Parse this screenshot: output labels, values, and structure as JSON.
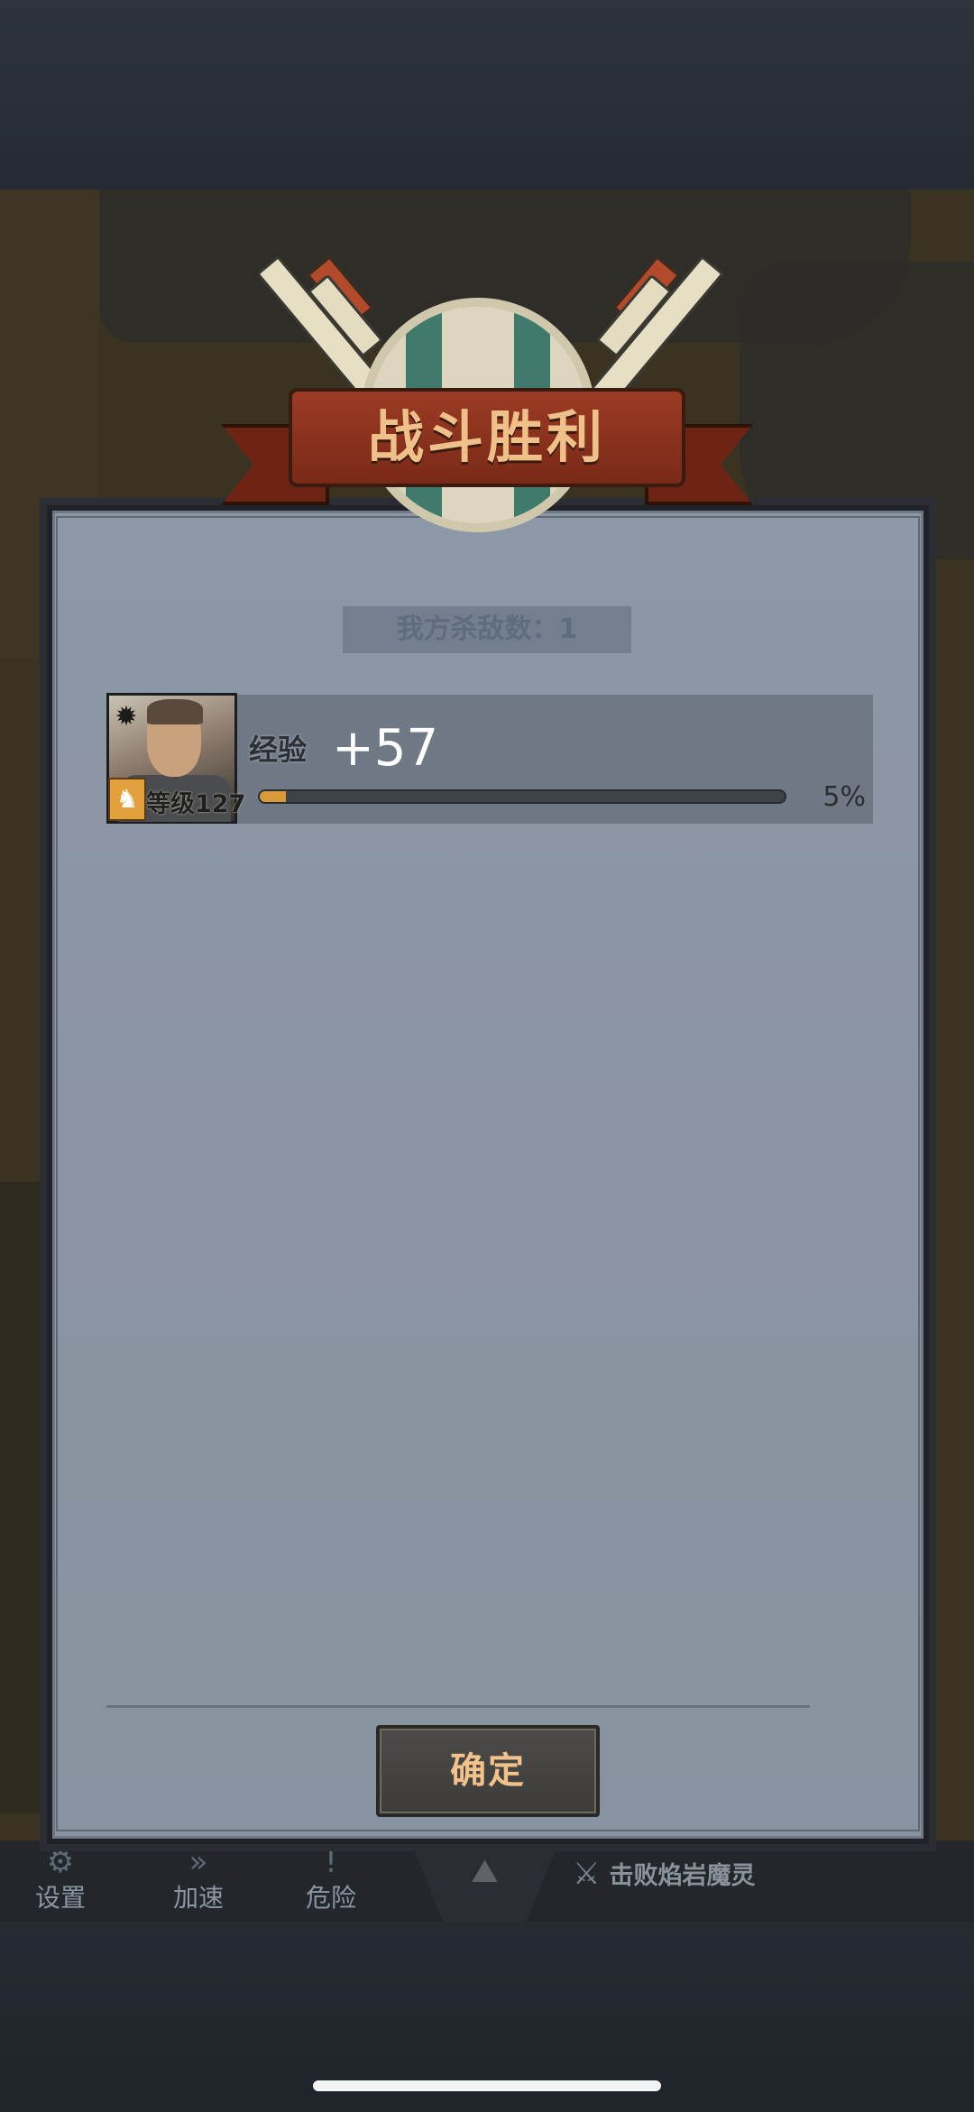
{
  "title": "战斗胜利",
  "kill_count_label": "我方杀敌数：1",
  "reward": {
    "exp_label": "经验",
    "exp_gain": "+57",
    "level_label": "等级127",
    "progress_percent_label": "5%",
    "progress_fraction": 0.05
  },
  "confirm_label": "确定",
  "hud": {
    "settings_label": "设置",
    "speed_label": "加速",
    "danger_label": "危险",
    "quest_text": "击败焰岩魔灵"
  },
  "icons": {
    "settings": "gear-icon",
    "speed": "fast-forward-icon",
    "danger": "warning-icon",
    "quest": "crossed-swords-icon",
    "portrait_element": "sun-icon",
    "portrait_class": "class-icon"
  },
  "colors": {
    "title_text": "#f0c08a",
    "banner": "#9b3b24",
    "progress_fill": "#d99b3a",
    "confirm_text": "#f2c28c"
  }
}
